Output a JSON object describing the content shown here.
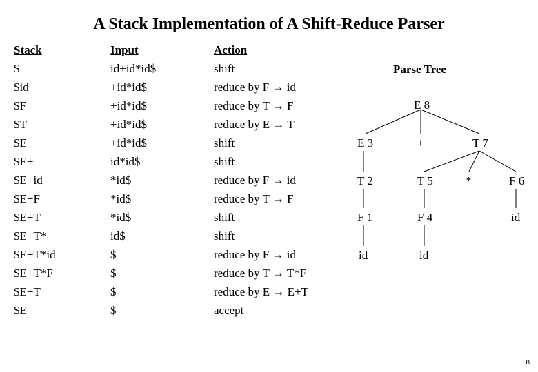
{
  "title": "A Stack Implementation of A Shift-Reduce Parser",
  "headers": {
    "stack": "Stack",
    "input": "Input",
    "action": "Action"
  },
  "rows": [
    {
      "stack": "$",
      "input": "id+id*id$",
      "action": "shift"
    },
    {
      "stack": "$id",
      "input": "+id*id$",
      "action": "reduce by F → id"
    },
    {
      "stack": "$F",
      "input": "+id*id$",
      "action": "reduce by T → F"
    },
    {
      "stack": "$T",
      "input": "+id*id$",
      "action": "reduce by E → T"
    },
    {
      "stack": "$E",
      "input": "+id*id$",
      "action": "shift"
    },
    {
      "stack": "$E+",
      "input": "id*id$",
      "action": "shift"
    },
    {
      "stack": "$E+id",
      "input": "*id$",
      "action": "reduce by F → id"
    },
    {
      "stack": "$E+F",
      "input": "*id$",
      "action": "reduce by T → F"
    },
    {
      "stack": "$E+T",
      "input": "*id$",
      "action": "shift"
    },
    {
      "stack": "$E+T*",
      "input": "id$",
      "action": "shift"
    },
    {
      "stack": "$E+T*id",
      "input": "$",
      "action": "reduce by F → id"
    },
    {
      "stack": "$E+T*F",
      "input": "$",
      "action": "reduce by T → T*F"
    },
    {
      "stack": "$E+T",
      "input": "$",
      "action": "reduce by E → E+T"
    },
    {
      "stack": "$E",
      "input": "$",
      "action": "accept"
    }
  ],
  "tree_title": "Parse Tree",
  "tree_nodes": {
    "E8": "E  8",
    "E3": "E  3",
    "plus": "+",
    "T7": "T  7",
    "T2": "T  2",
    "T5": "T  5",
    "star": "*",
    "F6": "F 6",
    "F1": "F  1",
    "F4": "F  4",
    "id_r": "id",
    "id_a": "id",
    "id_b": "id"
  },
  "page_number": "8"
}
